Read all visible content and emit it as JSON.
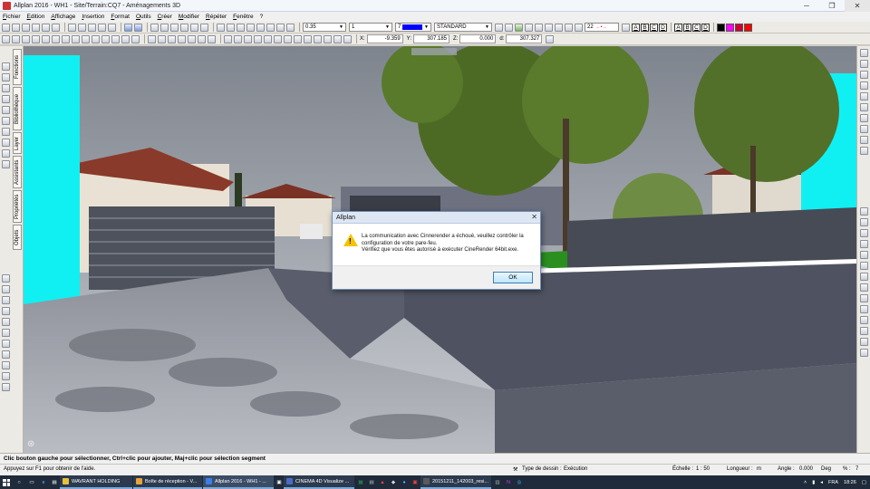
{
  "window": {
    "title": "Allplan 2016 - WH1 - Site/Terrain:CQ7 - Aménagements 3D",
    "minimize": "─",
    "maximize": "❐",
    "close": "✕"
  },
  "menu": [
    "Fichier",
    "Edition",
    "Affichage",
    "Insertion",
    "Format",
    "Outils",
    "Créer",
    "Modifier",
    "Répéter",
    "Fenêtre",
    "?"
  ],
  "format_bar": {
    "pen_value": "0.35",
    "line_value": "1",
    "color_value": "7",
    "layer_value": "STANDARD",
    "text_size": "22",
    "letters": [
      "A",
      "B",
      "C",
      "D",
      "A",
      "B",
      "C",
      "D"
    ],
    "colors": [
      "#000000",
      "#ff00ff",
      "#cc0033",
      "#ff0000"
    ]
  },
  "coordinates": {
    "x_label": "X:",
    "x_value": "-9.359",
    "y_label": "Y:",
    "y_value": "307.185",
    "z_label": "Z:",
    "z_value": "0.000",
    "d_label": "d:",
    "d_value": "307.327"
  },
  "palette_tabs": [
    "Fonctions",
    "Bibliothèque",
    "Layer",
    "Assistants",
    "Propriétés",
    "Objets"
  ],
  "dialog": {
    "title": "Allplan",
    "close": "✕",
    "line1": "La communication avec Cinnerender a échoué, veuillez contrôler la configuration de votre pare-feu.",
    "line2": "Vérifiez que vous êtes autorisé à exécuter CineRender 64bit.exe.",
    "ok": "OK"
  },
  "status_line": "Clic bouton gauche pour sélectionner, Ctrl+clic pour ajouter, Maj+clic pour sélection segment",
  "status_bar": {
    "help": "Appuyez sur F1 pour obtenir de l'aide.",
    "drawing_type_label": "Type de dessin :",
    "drawing_type_value": "Exécution",
    "scale_label": "Échelle :",
    "scale_value": "1 : 50",
    "length_label": "Longueur :",
    "length_value": "m",
    "angle_label": "Angle :",
    "angle_value": "0.000",
    "angle_unit": "Deg",
    "percent_label": "% :",
    "percent_value": "7"
  },
  "taskbar": {
    "tasks": [
      {
        "label": "WAVRANT HOLDING",
        "color": "#e8c23a"
      },
      {
        "label": "Boîte de réception - V...",
        "color": "#e8a33a"
      },
      {
        "label": "Allplan 2016 - WH1 - ...",
        "color": "#3a7ee8"
      },
      {
        "label": "CINEMA 4D Visualize ...",
        "color": "#4a6cc4"
      },
      {
        "label": "20151211_142003_resi...",
        "color": "#5a5a5a"
      }
    ],
    "language": "FRA",
    "time": "18:26"
  }
}
